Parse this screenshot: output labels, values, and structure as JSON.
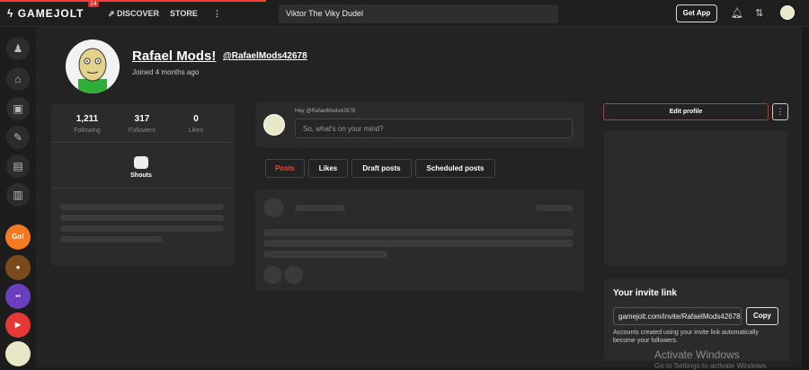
{
  "topbar": {
    "logo": "GAMEJOLT",
    "badge": "14",
    "discover": "DISCOVER",
    "store": "STORE",
    "more": "⋮",
    "search_value": "Viktor The Viky Dudel",
    "get_app": "Get App"
  },
  "profile": {
    "name": "Rafael Mods!",
    "handle": "@RafaelMods42678",
    "joined": "Joined 4 months ago"
  },
  "stats": [
    {
      "value": "1,211",
      "label": "Following"
    },
    {
      "value": "317",
      "label": "Followers"
    },
    {
      "value": "0",
      "label": "Likes"
    }
  ],
  "shouts_label": "Shouts",
  "composer": {
    "hey": "Hey @RafaelMods42678",
    "placeholder": "So, what's on your mind?"
  },
  "tabs": [
    "Posts",
    "Likes",
    "Draft posts",
    "Scheduled posts"
  ],
  "sidebar_right": {
    "edit_profile": "Edit profile",
    "more": "⋮",
    "invite_title": "Your invite link",
    "invite_link": "gamejolt.com/invite/RafaelMods42678",
    "copy": "Copy",
    "invite_note": "Accounts created using your invite link automatically become your followers."
  },
  "watermark": {
    "line1": "Activate Windows",
    "line2": "Go to Settings to activate Windows."
  },
  "colors": {
    "accent": "#ff3c3c",
    "background": "#191919",
    "panel": "#2b2b2b"
  }
}
